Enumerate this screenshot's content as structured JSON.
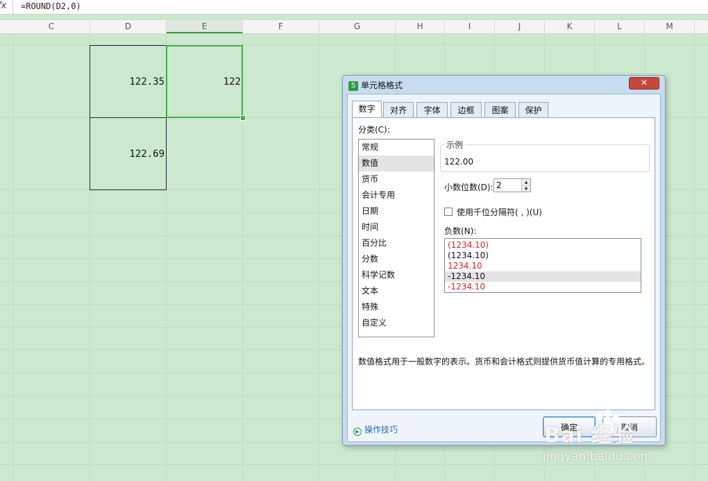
{
  "formula_bar": {
    "fx": "fx",
    "formula": "=ROUND(D2,0)"
  },
  "columns": [
    "C",
    "D",
    "E",
    "F",
    "G",
    "H",
    "I",
    "J",
    "K",
    "L",
    "M"
  ],
  "cells": {
    "d2": "122.35",
    "e2": "122",
    "d3": "122.69"
  },
  "dialog": {
    "title": "单元格格式",
    "logo": "S",
    "close": "✕",
    "tabs": [
      "数字",
      "对齐",
      "字体",
      "边框",
      "图案",
      "保护"
    ],
    "category_label": "分类(C):",
    "categories": [
      "常规",
      "数值",
      "货币",
      "会计专用",
      "日期",
      "时间",
      "百分比",
      "分数",
      "科学记数",
      "文本",
      "特殊",
      "自定义"
    ],
    "selected_category": "数值",
    "sample_title": "示例",
    "sample_value": "122.00",
    "decimal_label": "小数位数(D):",
    "decimal_value": "2",
    "thousands_label": "使用千位分隔符( , )(U)",
    "negative_label": "负数(N):",
    "negative_options": [
      "(1234.10)",
      "(1234.10)",
      "1234.10",
      "-1234.10",
      "-1234.10"
    ],
    "description": "数值格式用于一般数字的表示。货币和会计格式则提供货币值计算的专用格式。",
    "tips": "操作技巧",
    "ok": "确定",
    "cancel": "取消"
  },
  "watermark": {
    "logo": "Bai 经验",
    "url": "jingyan.baidu.com"
  },
  "colors": {
    "sheet_bg": "#cce8cf",
    "selection": "#4aa84e",
    "negative_red": "#d22222",
    "link_blue": "#2b6cb0"
  }
}
